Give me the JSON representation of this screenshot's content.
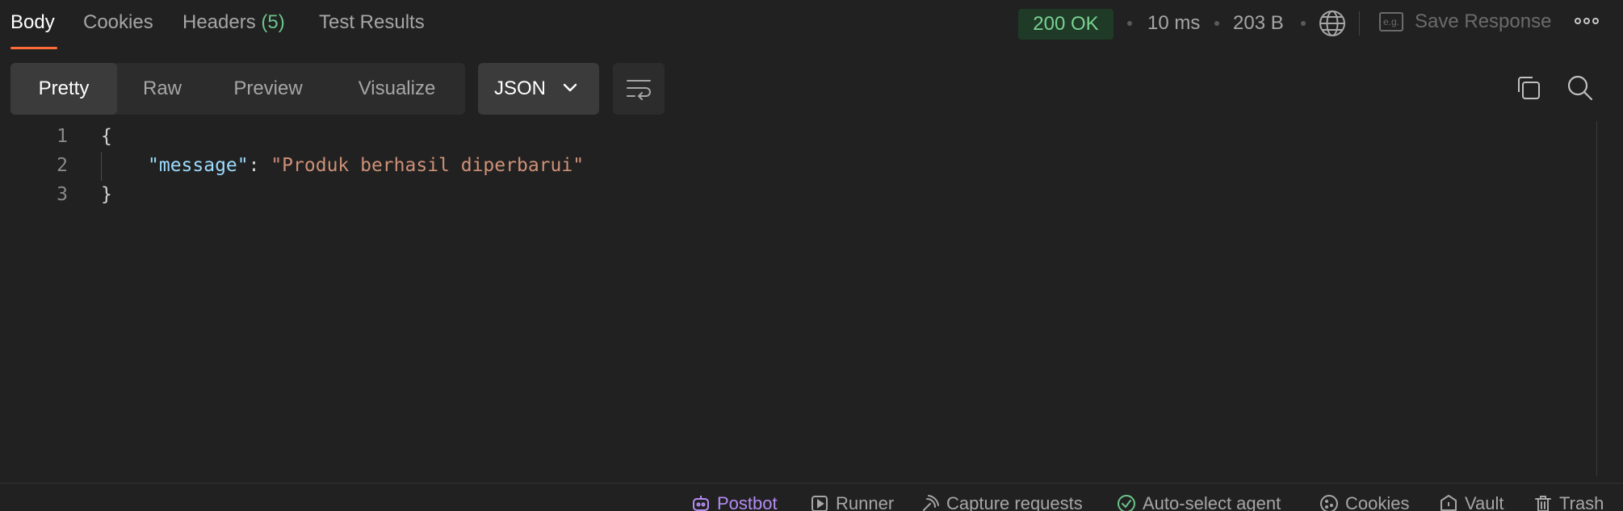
{
  "tabs": {
    "body": "Body",
    "cookies": "Cookies",
    "headers": "Headers",
    "headers_count": "(5)",
    "test_results": "Test Results"
  },
  "response": {
    "status": "200 OK",
    "time": "10 ms",
    "size": "203 B",
    "save_response": "Save Response",
    "save_icon_text": "e.g."
  },
  "view_modes": {
    "pretty": "Pretty",
    "raw": "Raw",
    "preview": "Preview",
    "visualize": "Visualize",
    "format": "JSON"
  },
  "editor": {
    "line_numbers": [
      "1",
      "2",
      "3"
    ],
    "open_brace": "{",
    "key": "\"message\"",
    "colon": ": ",
    "value": "\"Produk berhasil diperbarui\"",
    "close_brace": "}"
  },
  "footer": {
    "postbot": "Postbot",
    "runner": "Runner",
    "capture": "Capture requests",
    "agent": "Auto-select agent",
    "cookies": "Cookies",
    "vault": "Vault",
    "trash": "Trash"
  },
  "colors": {
    "accent": "#ff6c37",
    "status_ok": "#79d292",
    "json_key": "#9cdcfe",
    "json_string": "#ce9178",
    "postbot": "#b48cf2"
  },
  "icons": [
    "globe-icon",
    "example-icon",
    "more-icon",
    "chevron-down-icon",
    "wrap-lines-icon",
    "copy-icon",
    "search-icon",
    "postbot-icon",
    "runner-icon",
    "capture-icon",
    "check-circle-icon",
    "cookie-icon",
    "vault-icon",
    "trash-icon"
  ]
}
